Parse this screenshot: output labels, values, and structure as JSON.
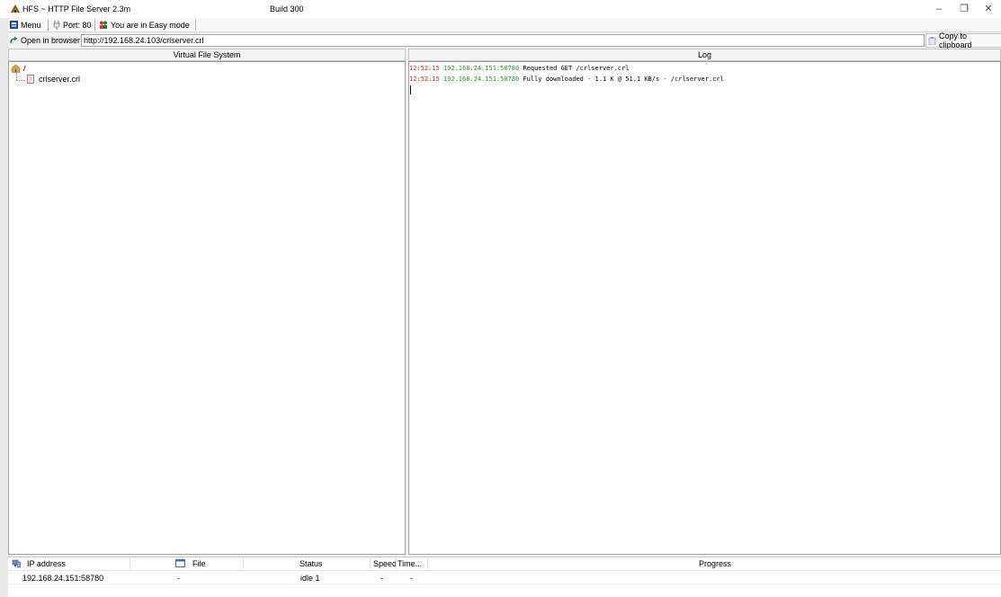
{
  "window": {
    "title": "HFS ~ HTTP File Server 2.3m",
    "build": "Build 300",
    "controls": {
      "minimize": "–",
      "restore": "❐",
      "close": "✕"
    }
  },
  "toolbar": {
    "menu_label": "Menu",
    "port_label": "Port: 80",
    "mode_label": "You are in Easy mode"
  },
  "urlbar": {
    "open_label": "Open in browser",
    "url": "http://192.168.24.103/crlserver.crl",
    "copy_label": "Copy to clipboard"
  },
  "vfs": {
    "header": "Virtual File System",
    "root_label": "/",
    "files": [
      {
        "name": "crlserver.crl"
      }
    ]
  },
  "log": {
    "header": "Log",
    "entries": [
      {
        "time": "12:52:15",
        "address": "192.168.24.151:58780",
        "message": "Requested GET /crlserver.crl"
      },
      {
        "time": "12:52:15",
        "address": "192.168.24.151:58780",
        "message": "Fully downloaded - 1.1 K @ 51.1 KB/s - /crlserver.crl"
      }
    ]
  },
  "connections": {
    "columns": {
      "ip": "IP address",
      "file": "File",
      "status": "Status",
      "speed": "Speed",
      "time": "Time...",
      "progress": "Progress"
    },
    "rows": [
      {
        "ip": "192.168.24.151:58780",
        "file": "-",
        "status": "idle 1",
        "speed": "-",
        "time": "-",
        "progress": ""
      }
    ]
  },
  "colors": {
    "log_time": "#d42020",
    "log_address": "#1e9a1e"
  }
}
